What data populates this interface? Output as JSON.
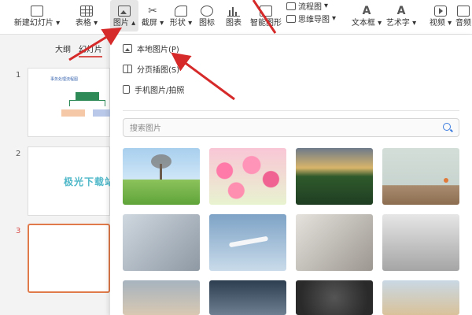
{
  "ribbon": {
    "new_slide": "新建幻灯片",
    "table": "表格",
    "picture": "图片",
    "screenshot": "截屏",
    "shape": "形状",
    "icon": "图标",
    "chart": "图表",
    "smartart": "智能图形",
    "flowchart": "流程图",
    "mindmap": "思维导图",
    "textbox": "文本框",
    "wordart": "艺术字",
    "video": "视频",
    "audio": "音频"
  },
  "panel": {
    "tab_outline": "大纲",
    "tab_slides": "幻灯片",
    "slide_numbers": [
      "1",
      "2",
      "3"
    ],
    "slide1_title": "事务处理流程图",
    "slide2_watermark": "极光下载站"
  },
  "dropdown": {
    "local_picture": "本地图片(P)",
    "split_picture": "分页插图(S)",
    "phone_picture": "手机图片/拍照",
    "search_placeholder": "搜索图片"
  },
  "colors": {
    "accent_red": "#d9534f",
    "active_slide_border": "#e07a4a",
    "search_icon": "#3a7be0",
    "arrow": "#d62a2a"
  }
}
